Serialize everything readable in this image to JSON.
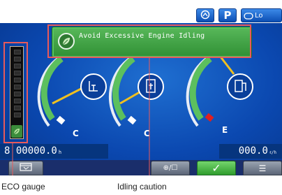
{
  "top_bar": {
    "buttons": [
      {
        "name": "fuel-icon",
        "label": ""
      },
      {
        "name": "parking",
        "label": "P"
      },
      {
        "name": "lo",
        "label": "Lo"
      }
    ]
  },
  "idle_banner": {
    "text": "Avoid Excessive Engine Idling"
  },
  "gauges": [
    {
      "name": "engine-coolant-temperature",
      "low_label": "C",
      "icon": "coolant-temperature-icon",
      "level": 0.1
    },
    {
      "name": "hydraulic-oil-temperature",
      "low_label": "C",
      "icon": "hydraulic-oil-temperature-icon",
      "level": 0.1
    },
    {
      "name": "fuel-level",
      "low_label": "E",
      "icon": "fuel-pump-icon",
      "level": 0.7
    }
  ],
  "odometer": {
    "value": "8 00000.0",
    "unit": "h"
  },
  "trip": {
    "value": "000.0",
    "unit": "ℓ/h"
  },
  "bottom_buttons": [
    {
      "name": "eco-calendar",
      "label": ""
    },
    {
      "name": "switch-display",
      "label": "⊕/☐"
    },
    {
      "name": "confirm",
      "label": "✓"
    },
    {
      "name": "menu",
      "label": "☰"
    }
  ],
  "captions": {
    "eco_gauge": "ECO gauge",
    "idling_caution": "Idling caution"
  },
  "colors": {
    "screen_blue": "#0b48b0",
    "banner_green": "#3f9f43",
    "callout_red": "#e85a5a",
    "needle": "#f0c020"
  }
}
